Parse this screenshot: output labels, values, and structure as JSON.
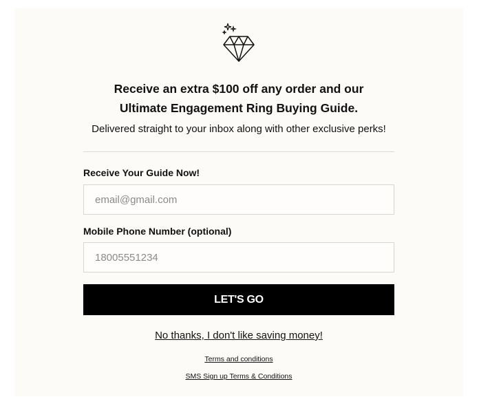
{
  "icons": {
    "diamond": "diamond-with-sparkles-icon"
  },
  "offer": {
    "headline_line1": "Receive an extra $100 off any order and our",
    "headline_line2": "Ultimate Engagement Ring Buying Guide.",
    "subline": "Delivered straight to your inbox along with other exclusive perks!"
  },
  "form": {
    "email_label": "Receive Your Guide Now!",
    "email_placeholder": "email@gmail.com",
    "email_value": "",
    "phone_label": "Mobile Phone Number (optional)",
    "phone_placeholder": "18005551234",
    "phone_value": "",
    "submit_label": "LET'S GO"
  },
  "links": {
    "decline": "No thanks, I don't like saving money!",
    "terms": "Terms and conditions",
    "sms_terms": "SMS Sign up Terms & Conditions"
  },
  "colors": {
    "modal_background": "#fdfbf8",
    "button_background": "#000000",
    "button_text": "#ffffff",
    "text": "#111111"
  }
}
